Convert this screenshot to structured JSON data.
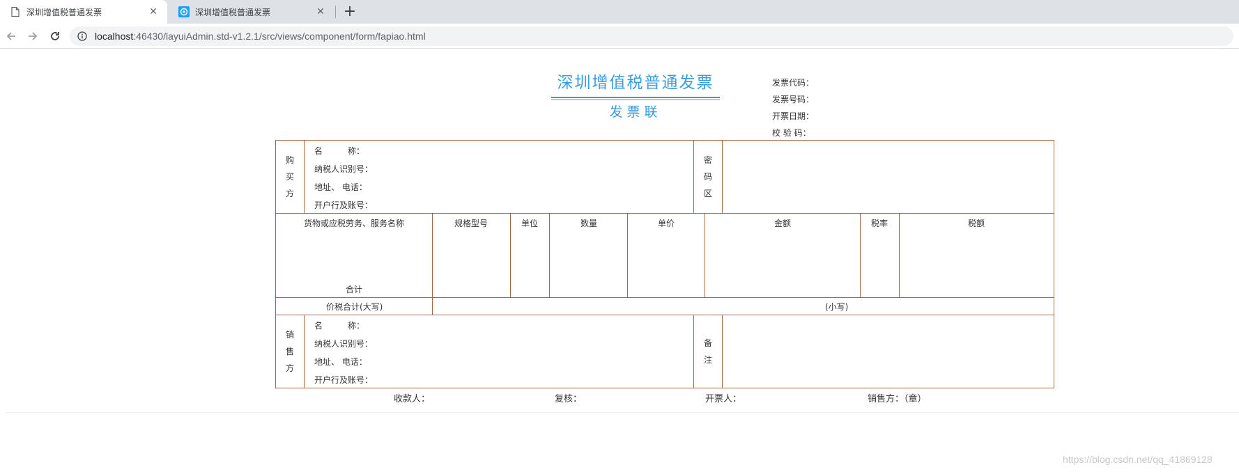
{
  "browser": {
    "tabs": [
      {
        "title": "深圳增值税普通发票",
        "active": true,
        "icon": "page-icon"
      },
      {
        "title": "深圳增值税普通发票",
        "active": false,
        "icon": "layui-icon"
      }
    ],
    "address": {
      "host": "localhost",
      "rest": ":46430/layuiAdmin.std-v1.2.1/src/views/component/form/fapiao.html"
    }
  },
  "invoice": {
    "title": "深圳增值税普通发票",
    "subtitle": "发票联",
    "meta": {
      "code_label": "发票代码：",
      "number_label": "发票号码：",
      "date_label": "开票日期：",
      "check_label": "校 验 码："
    },
    "buyer": {
      "side_label": [
        "购",
        "买",
        "方"
      ],
      "name_label": "名　　　称：",
      "tax_id_label": "纳税人识别号：",
      "address_label": "地址、  电话：",
      "bank_label": "开户行及账号："
    },
    "cipher_label": [
      "密",
      "码",
      "区"
    ],
    "items_header": {
      "goods": "货物或应税劳务、服务名称",
      "spec": "规格型号",
      "unit": "单位",
      "qty": "数量",
      "price": "单价",
      "amount": "金额",
      "rate": "税率",
      "tax": "税额"
    },
    "total_label": "合计",
    "total_capital_label": "价税合计(大写)",
    "total_small_label": "(小写)",
    "seller": {
      "side_label": [
        "销",
        "售",
        "方"
      ],
      "name_label": "名　　　称：",
      "tax_id_label": "纳税人识别号：",
      "address_label": "地址、  电话：",
      "bank_label": "开户行及账号："
    },
    "remark_label": [
      "备",
      "注"
    ],
    "footer": {
      "payee": "收款人：",
      "reviewer": "复核：",
      "drawer": "开票人：",
      "seller_seal": "销售方：（章）"
    }
  },
  "watermark": "https://blog.csdn.net/qq_41869128",
  "colors": {
    "accent": "#3a9be0",
    "table_border": "#a0694a"
  }
}
